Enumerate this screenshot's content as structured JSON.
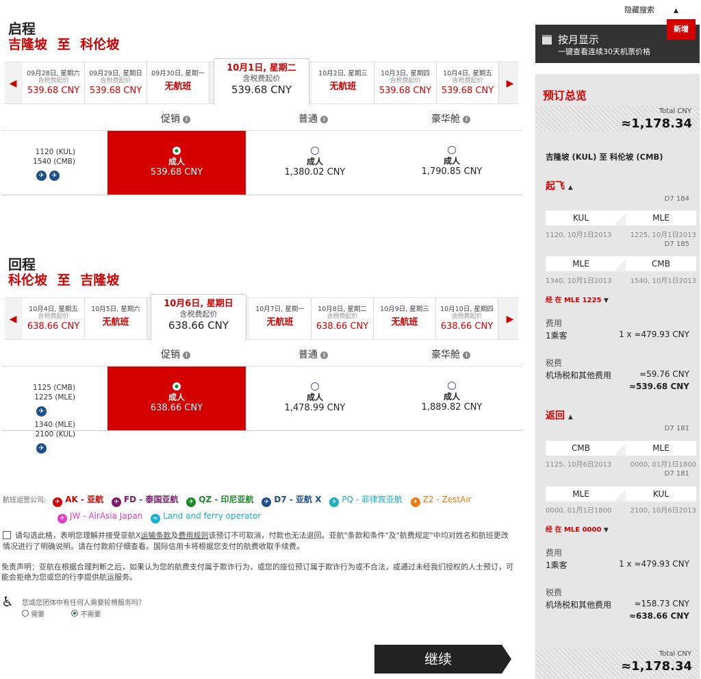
{
  "hide_search": "隐藏搜索",
  "outbound": {
    "title": "启程",
    "route": "吉隆坡 至 科伦坡",
    "dates": [
      {
        "d": "09月28日, 星期六",
        "s": "含税费起价",
        "p": "539.68 CNY"
      },
      {
        "d": "09月29日, 星期日",
        "s": "含税费起价",
        "p": "539.68 CNY"
      },
      {
        "d": "09月30日, 星期一",
        "n": "无航班"
      },
      {
        "d": "10月1日, 星期二",
        "s": "含税费起价",
        "p": "539.68 CNY"
      },
      {
        "d": "10月2日, 星期三",
        "n": "无航班"
      },
      {
        "d": "10月3日, 星期四",
        "s": "含税费起价",
        "p": "539.68 CNY"
      },
      {
        "d": "10月4日, 星期五",
        "s": "含税费起价",
        "p": "539.68 CNY"
      }
    ],
    "cols": [
      "促销",
      "普通",
      "豪华舱"
    ],
    "times": [
      "1120  (KUL)",
      "1540  (CMB)"
    ],
    "fares": [
      {
        "a": "成人",
        "v": "539.68 CNY"
      },
      {
        "a": "成人",
        "v": "1,380.02 CNY"
      },
      {
        "a": "成人",
        "v": "1,790.85 CNY"
      }
    ]
  },
  "inbound": {
    "title": "回程",
    "route": "科伦坡 至 吉隆坡",
    "dates": [
      {
        "d": "10月4日, 星期五",
        "s": "含税费起价",
        "p": "638.66 CNY"
      },
      {
        "d": "10月5日, 星期六",
        "n": "无航班"
      },
      {
        "d": "10月6日, 星期日",
        "s": "含税费起价",
        "p": "638.66 CNY"
      },
      {
        "d": "10月7日, 星期一",
        "n": "无航班"
      },
      {
        "d": "10月8日, 星期二",
        "s": "含税费起价",
        "p": "638.66 CNY"
      },
      {
        "d": "10月9日, 星期三",
        "n": "无航班"
      },
      {
        "d": "10月10日, 星期四",
        "s": "含税费起价",
        "p": "638.66 CNY"
      }
    ],
    "cols": [
      "促销",
      "普通",
      "豪华舱"
    ],
    "times": [
      "1125  (CMB)",
      "1225  (MLE)",
      "1340  (MLE)",
      "2100  (KUL)"
    ],
    "fares": [
      {
        "a": "成人",
        "v": "638.66 CNY"
      },
      {
        "a": "成人",
        "v": "1,478.99 CNY"
      },
      {
        "a": "成人",
        "v": "1,889.82 CNY"
      }
    ]
  },
  "operators": {
    "label": "航班运营公司:",
    "items": [
      {
        "t": "AK - 亚航",
        "c": "#d40000"
      },
      {
        "t": "FD - 泰国亚航",
        "c": "#7a1a6a"
      },
      {
        "t": "QZ - 印尼亚航",
        "c": "#1a8a2a"
      },
      {
        "t": "D7 - 亚航 X",
        "c": "#1d4e8c"
      },
      {
        "t": "PQ - 菲律宾亚航",
        "c": "#1ab0c0"
      },
      {
        "t": "Z2 - ZestAir",
        "c": "#f07a10"
      },
      {
        "t": "JW - AirAsia Japan",
        "c": "#e040c0"
      },
      {
        "t": "Land and ferry operator",
        "c": "#1ab0d0"
      }
    ]
  },
  "terms": {
    "pre": "请勾选此格，表明您理解并接受亚航X",
    "l1": "运输条款",
    "mid": "及",
    "l2": "费用规则",
    "post": "该预订不可取消，付款也无法退回。亚航\"条款和条件\"及\"航费规定\"中均对姓名和航班更改情况进行了明确说明。请在付款前仔细查看。国际信用卡将根据您支付的航费收取手续费。"
  },
  "disclaimer": "免责声明：亚航在根据合理判断之后，如果认为您的航费支付属于欺诈行为，或您的座位预订属于欺诈行为或不合法，或通过未经我们授权的人士预订，可能会拒绝为您或您的行李提供航运服务。",
  "assist": {
    "q": "您或您团体中有任何人需要轮椅服务吗？",
    "yes": "需要",
    "no": "不需要"
  },
  "continue": "继续",
  "monthly": {
    "title": "按月显示",
    "sub": "一键查看连续30天机票价格",
    "badge": "新增"
  },
  "summary": {
    "title": "预订总览",
    "total_label": "Total CNY",
    "total": "≈1,178.34",
    "route": "吉隆坡 (KUL) 至 科伦坡 (CMB)",
    "dep": {
      "label": "起飞",
      "segs": [
        {
          "fl": "D7 184",
          "from": "KUL",
          "to": "MLE",
          "t1": "1120, 10月1日2013",
          "t2": "1225, 10月1日2013"
        },
        {
          "fl": "D7 185",
          "from": "MLE",
          "to": "CMB",
          "t1": "1340, 10月1日2013",
          "t2": "1540, 10月1日2013"
        }
      ],
      "stop": "经 在 MLE 1225",
      "fee": "费用",
      "pax": "1乘客",
      "paxv": "1 x ≈479.93 CNY",
      "tax": "税费",
      "taxl": "机场税和其他费用",
      "taxv": "≈59.76 CNY",
      "sub": "≈539.68 CNY"
    },
    "ret": {
      "label": "返回",
      "segs": [
        {
          "fl": "D7 181",
          "from": "CMB",
          "to": "MLE",
          "t1": "1125, 10月6日2013",
          "t2": "0000, 01月1日1800"
        },
        {
          "fl": "D7 181",
          "from": "MLE",
          "to": "KUL",
          "t1": "0000, 01月1日1800",
          "t2": "2100, 10月6日2013"
        }
      ],
      "stop": "经 在 MLE 0000",
      "fee": "费用",
      "pax": "1乘客",
      "paxv": "1 x ≈479.93 CNY",
      "tax": "税费",
      "taxl": "机场税和其他费用",
      "taxv": "≈158.73 CNY",
      "sub": "≈638.66 CNY"
    }
  }
}
